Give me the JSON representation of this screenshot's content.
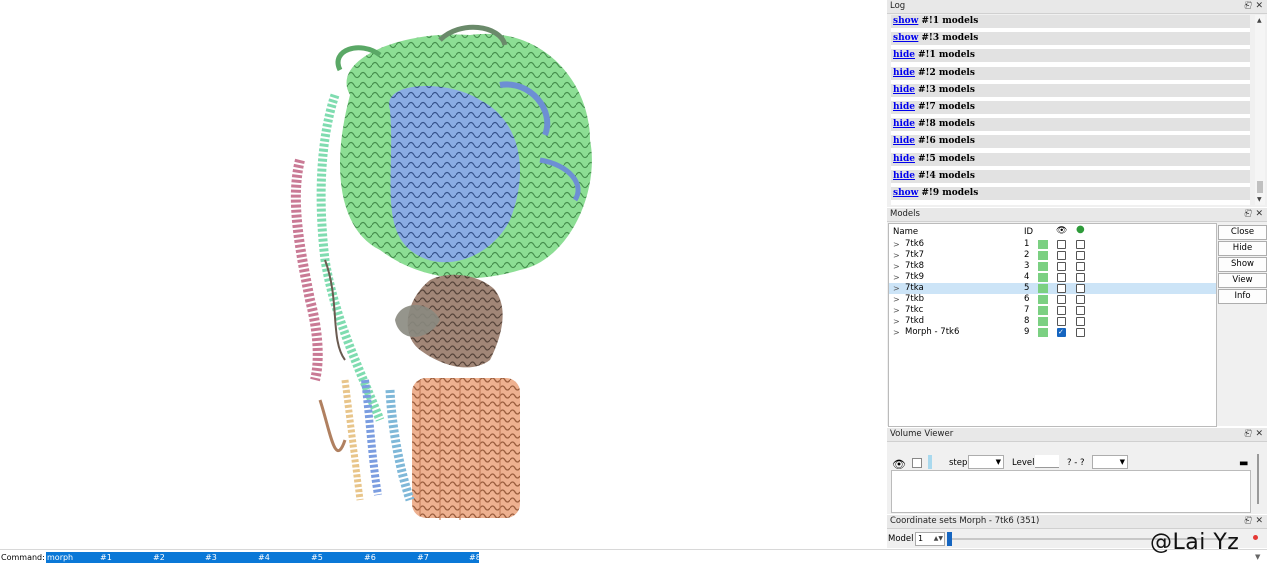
{
  "log": {
    "title": "Log",
    "entries": [
      {
        "action": "show",
        "text": "#!1 models"
      },
      {
        "action": "show",
        "text": "#!3 models"
      },
      {
        "action": "hide",
        "text": "#!1 models"
      },
      {
        "action": "hide",
        "text": "#!2 models"
      },
      {
        "action": "hide",
        "text": "#!3 models"
      },
      {
        "action": "hide",
        "text": "#!7 models"
      },
      {
        "action": "hide",
        "text": "#!8 models"
      },
      {
        "action": "hide",
        "text": "#!6 models"
      },
      {
        "action": "hide",
        "text": "#!5 models"
      },
      {
        "action": "hide",
        "text": "#!4 models"
      },
      {
        "action": "show",
        "text": "#!9 models"
      }
    ]
  },
  "models": {
    "title": "Models",
    "headers": {
      "name": "Name",
      "id": "ID"
    },
    "rows": [
      {
        "name": "7tk6",
        "id": "1",
        "shown": false,
        "selected": false
      },
      {
        "name": "7tk7",
        "id": "2",
        "shown": false,
        "selected": false
      },
      {
        "name": "7tk8",
        "id": "3",
        "shown": false,
        "selected": false
      },
      {
        "name": "7tk9",
        "id": "4",
        "shown": false,
        "selected": false
      },
      {
        "name": "7tka",
        "id": "5",
        "shown": false,
        "selected": true
      },
      {
        "name": "7tkb",
        "id": "6",
        "shown": false,
        "selected": false
      },
      {
        "name": "7tkc",
        "id": "7",
        "shown": false,
        "selected": false
      },
      {
        "name": "7tkd",
        "id": "8",
        "shown": false,
        "selected": false
      },
      {
        "name": "Morph - 7tk6",
        "id": "9",
        "shown": true,
        "selected": false
      }
    ],
    "buttons": [
      "Close",
      "Hide",
      "Show",
      "View",
      "Info"
    ],
    "swatch_color": "#7bd082"
  },
  "volume_viewer": {
    "title": "Volume Viewer",
    "step_label": "step",
    "level_label": "Level",
    "range_text": "? - ?"
  },
  "coordinate_sets": {
    "title": "Coordinate sets Morph - 7tk6 (351)",
    "model_label": "Model",
    "model_value": "1"
  },
  "command": {
    "label": "Command:",
    "tokens": [
      "morph",
      "#1",
      "#2",
      "#3",
      "#4",
      "#5",
      "#6",
      "#7",
      "#8"
    ]
  },
  "watermark": "@Lai Yz",
  "colors": {
    "accent": "#0a78d7",
    "selection": "#cce4f7",
    "link": "#0000ee",
    "green_subunit": "#7fd88a",
    "blue_subunit": "#7b9de0",
    "brown_subunit": "#8d7060",
    "salmon_subunit": "#e9a987",
    "pink_subunit": "#c97a95",
    "teal_subunit": "#7fdcb0"
  }
}
